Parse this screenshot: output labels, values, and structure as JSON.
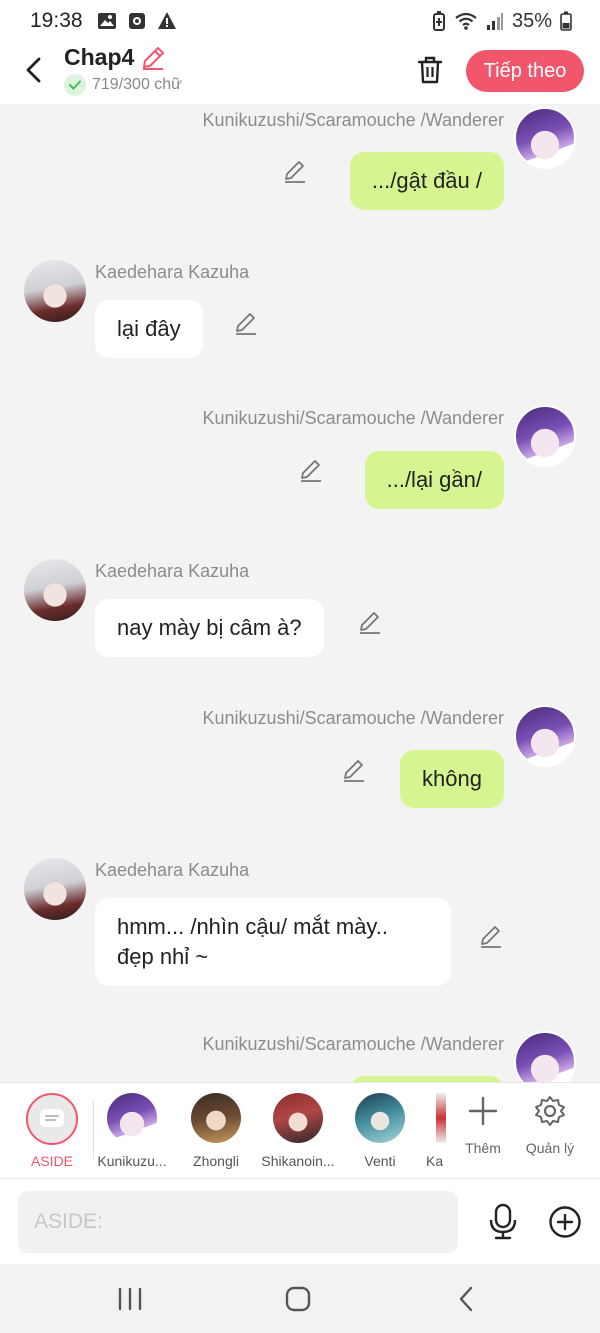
{
  "status_bar": {
    "time": "19:38",
    "battery": "35%",
    "icons": [
      "image-icon",
      "camera-icon",
      "alert-icon",
      "battery-saver-icon",
      "wifi-icon",
      "signal-icon",
      "battery-icon"
    ]
  },
  "header": {
    "title": "Chap4",
    "word_count": "719/300 chữ",
    "next_label": "Tiếp theo"
  },
  "colors": {
    "accent": "#f2566d",
    "outgoing_bubble": "#d6f590",
    "incoming_bubble": "#ffffff",
    "background": "#f3f3f3"
  },
  "messages": [
    {
      "sender": "Kunikuzushi/Scaramouche /Wanderer",
      "text": ".../gật đầu /",
      "side": "right"
    },
    {
      "sender": "Kaedehara Kazuha",
      "text": "lại đây",
      "side": "left"
    },
    {
      "sender": "Kunikuzushi/Scaramouche /Wanderer",
      "text": ".../lại gần/",
      "side": "right"
    },
    {
      "sender": "Kaedehara Kazuha",
      "text": "nay mày bị câm à?",
      "side": "left"
    },
    {
      "sender": "Kunikuzushi/Scaramouche /Wanderer",
      "text": "không",
      "side": "right"
    },
    {
      "sender": "Kaedehara Kazuha",
      "text": "hmm... /nhìn cậu/ mắt mày..",
      "text2": "đẹp nhỉ ~",
      "side": "left"
    },
    {
      "sender": "Kunikuzushi/Scaramouche /Wanderer",
      "text": "",
      "side": "right"
    }
  ],
  "characters": [
    {
      "name": "ASIDE"
    },
    {
      "name": "Kunikuzu..."
    },
    {
      "name": "Zhongli"
    },
    {
      "name": "Shikanoin..."
    },
    {
      "name": "Venti"
    },
    {
      "name": "Ka"
    }
  ],
  "tools": {
    "add_label": "Thêm",
    "manage_label": "Quản lý"
  },
  "input": {
    "placeholder": "ASIDE:"
  }
}
